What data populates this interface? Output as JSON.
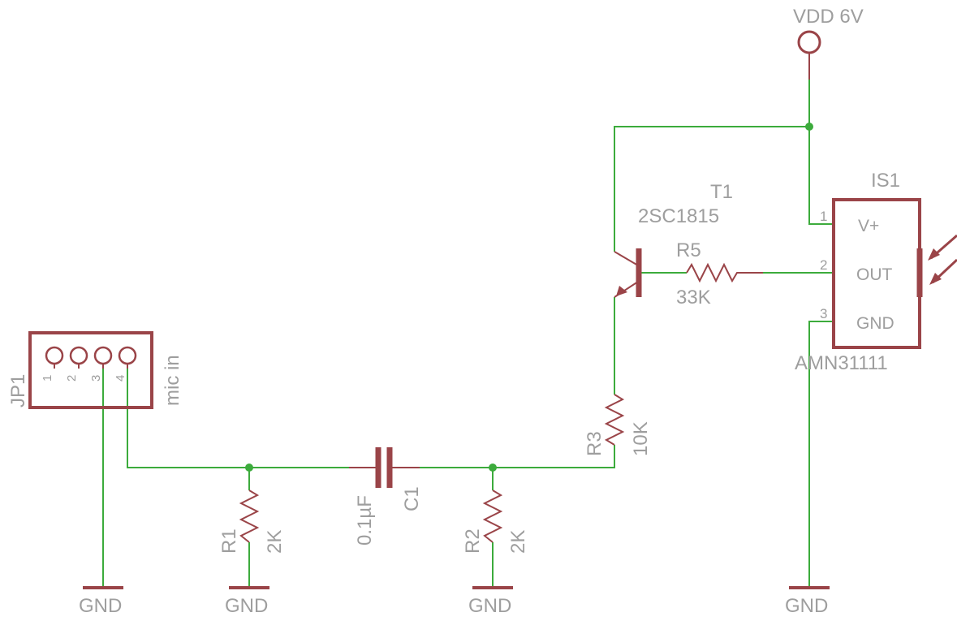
{
  "supply": {
    "label": "VDD 6V"
  },
  "ground": {
    "label": "GND"
  },
  "connector": {
    "ref": "JP1",
    "value": "mic in",
    "pins": [
      "1",
      "2",
      "3",
      "4"
    ]
  },
  "capacitor": {
    "ref": "C1",
    "value": "0.1µF"
  },
  "resistors": {
    "r1": {
      "ref": "R1",
      "value": "2K"
    },
    "r2": {
      "ref": "R2",
      "value": "2K"
    },
    "r3": {
      "ref": "R3",
      "value": "10K"
    },
    "r5": {
      "ref": "R5",
      "value": "33K"
    }
  },
  "transistor": {
    "ref": "T1",
    "part": "2SC1815"
  },
  "sensor": {
    "ref": "IS1",
    "part": "AMN31111",
    "pins": [
      {
        "num": "1",
        "name": "V+"
      },
      {
        "num": "2",
        "name": "OUT"
      },
      {
        "num": "3",
        "name": "GND"
      }
    ]
  },
  "colors": {
    "wire": "#3cab3c",
    "component": "#9a4448",
    "label": "#9e9e9e",
    "background": "#ffffff"
  }
}
